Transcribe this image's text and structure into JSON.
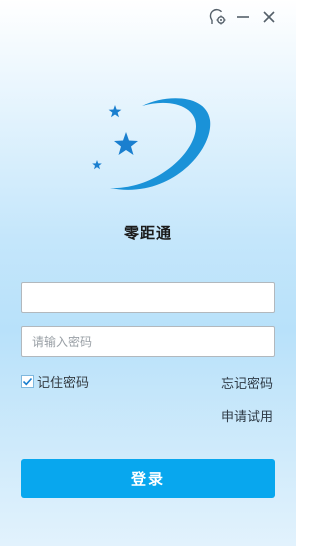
{
  "titlebar": {
    "settings_icon": "settings-icon",
    "minimize_icon": "minimize-icon",
    "close_icon": "close-icon"
  },
  "app": {
    "name": "零距通",
    "logo_icon": "star-orbit-logo"
  },
  "form": {
    "username": {
      "value": "",
      "placeholder": ""
    },
    "password": {
      "value": "",
      "placeholder": "请输入密码"
    },
    "remember": {
      "label": "记住密码",
      "checked": true
    },
    "forgot_label": "忘记密码",
    "apply_label": "申请试用",
    "login_label": "登录"
  },
  "colors": {
    "accent": "#08a7ee",
    "logo_blue": "#1a92d8",
    "background_top": "#ffffff",
    "background_mid": "#b8e1fa"
  }
}
